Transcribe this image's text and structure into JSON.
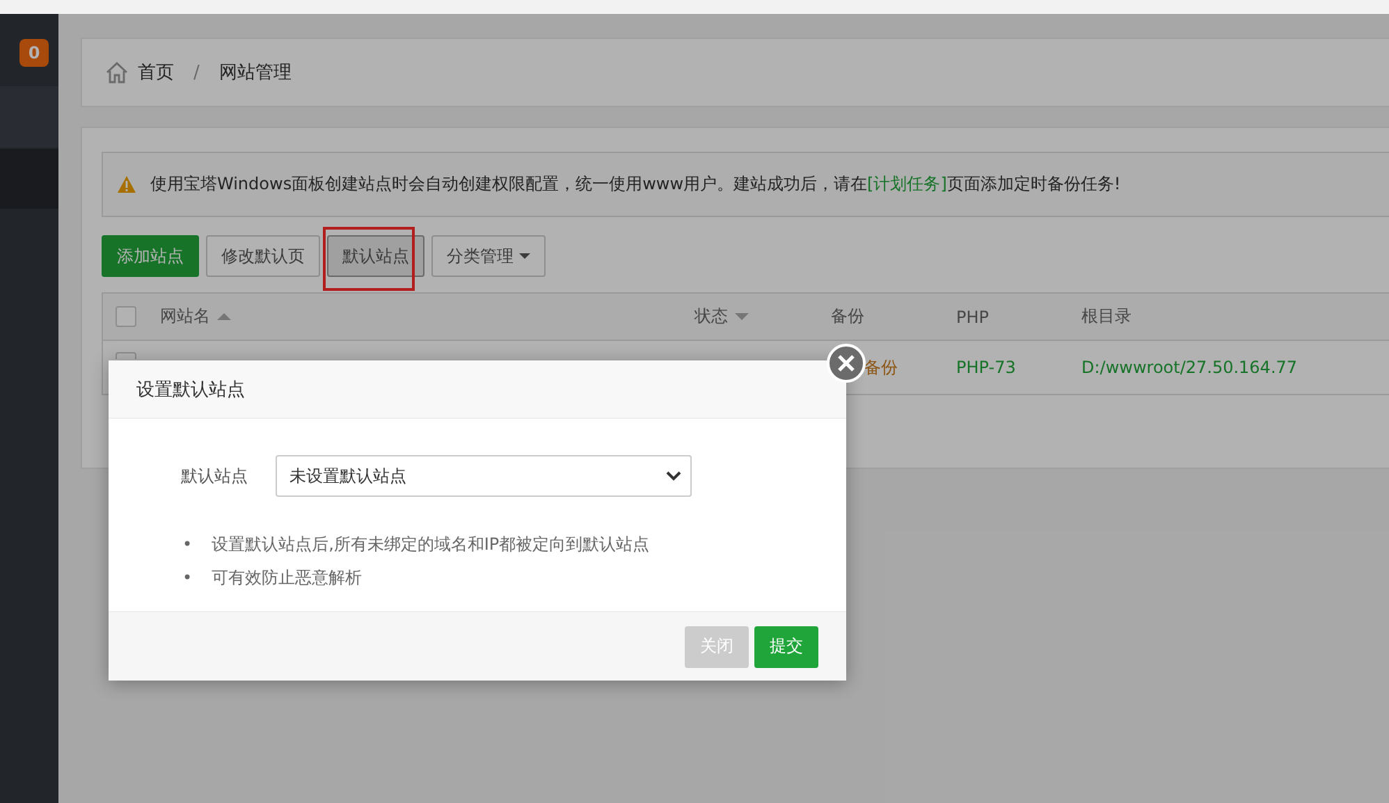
{
  "sidebar": {
    "badge": "0"
  },
  "breadcrumb": {
    "items": [
      {
        "label": "首页"
      },
      {
        "label": "网站管理"
      }
    ],
    "separator": "/"
  },
  "alert": {
    "text": "使用宝塔Windows面板创建站点时会自动创建权限配置，统一使用www用户。建站成功后，请在",
    "link": "[计划任务]",
    "after": "页面添加定时备份任务!"
  },
  "toolbar": [
    {
      "label": "添加站点",
      "kind": "primary",
      "highlighted": false
    },
    {
      "label": "修改默认页",
      "kind": "default",
      "highlighted": false
    },
    {
      "label": "默认站点",
      "kind": "default",
      "highlighted": true
    },
    {
      "label": "分类管理",
      "kind": "dropdown",
      "highlighted": false
    }
  ],
  "table": {
    "columns": [
      {
        "label": "网站名",
        "sort_ascending": true
      },
      {
        "label": "状态",
        "sort_ascending": false
      },
      {
        "label": "备份"
      },
      {
        "label": "PHP"
      },
      {
        "label": "根目录"
      }
    ],
    "header_checked": false,
    "rows": [
      {
        "checked": false,
        "backup": "备份",
        "php": "PHP-73",
        "root": "D:/wwwroot/27.50.164.77"
      }
    ]
  },
  "modal": {
    "title": "设置默认站点",
    "field_label": "默认站点",
    "select_value": "未设置默认站点",
    "notes": [
      {
        "marker": "•",
        "text": "设置默认站点后,所有未绑定的域名和IP都被定向到默认站点"
      },
      {
        "marker": "•",
        "text": "可有效防止恶意解析"
      }
    ],
    "buttons": [
      {
        "label": "关闭",
        "kind": "cancel"
      },
      {
        "label": "提交",
        "kind": "primary"
      }
    ]
  }
}
